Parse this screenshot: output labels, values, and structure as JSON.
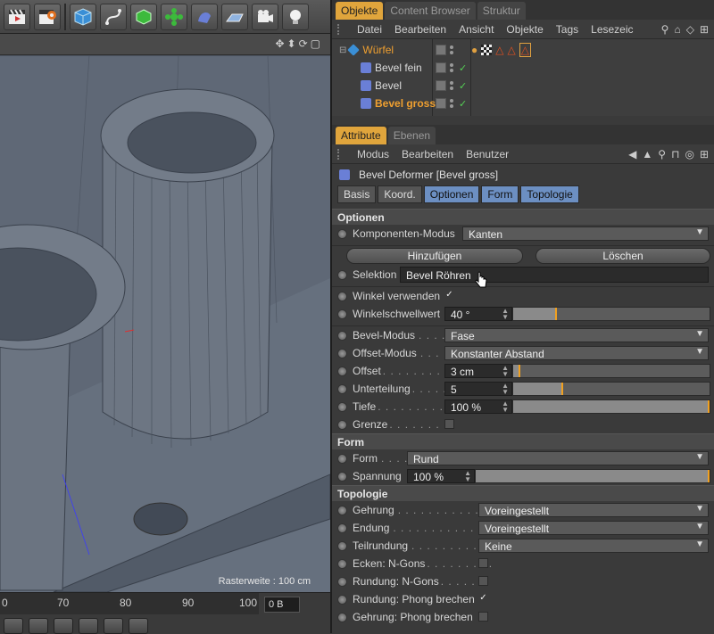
{
  "toolbar": {
    "icons": [
      "clapperboard-icon",
      "render-settings-icon",
      "cube-icon",
      "spline-icon",
      "generator-icon",
      "array-icon",
      "deformer-icon",
      "floor-icon",
      "camera-icon",
      "light-icon"
    ]
  },
  "viewport": {
    "raster_label": "Rasterweite : 100 cm"
  },
  "timeline": {
    "ticks": [
      "0",
      "70",
      "80",
      "90",
      "100"
    ],
    "frame_value": "0 B"
  },
  "object_manager": {
    "tabs": [
      "Objekte",
      "Content Browser",
      "Struktur"
    ],
    "menu": [
      "Datei",
      "Bearbeiten",
      "Ansicht",
      "Objekte",
      "Tags",
      "Lesezeic"
    ],
    "objects": [
      {
        "name": "Würfel",
        "level": 0,
        "selected": false
      },
      {
        "name": "Bevel fein",
        "level": 1,
        "selected": false
      },
      {
        "name": "Bevel",
        "level": 1,
        "selected": false
      },
      {
        "name": "Bevel gross",
        "level": 1,
        "selected": true
      }
    ]
  },
  "attribute_manager": {
    "tabs": [
      "Attribute",
      "Ebenen"
    ],
    "menu": [
      "Modus",
      "Bearbeiten",
      "Benutzer"
    ],
    "title": "Bevel Deformer [Bevel gross]",
    "subtabs": [
      "Basis",
      "Koord.",
      "Optionen",
      "Form",
      "Topologie"
    ],
    "optionen": {
      "header": "Optionen",
      "komponenten_label": "Komponenten-Modus",
      "komponenten_value": "Kanten",
      "add_button": "Hinzufügen",
      "delete_button": "Löschen",
      "selektion_label": "Selektion",
      "selektion_value": "Bevel Röhren",
      "winkel_verwenden_label": "Winkel verwenden",
      "winkel_verwenden_checked": "✓",
      "winkelschwellwert_label": "Winkelschwellwert",
      "winkelschwellwert_value": "40 °",
      "bevel_modus_label": "Bevel-Modus",
      "bevel_modus_value": "Fase",
      "offset_modus_label": "Offset-Modus",
      "offset_modus_value": "Konstanter Abstand",
      "offset_label": "Offset",
      "offset_value": "3 cm",
      "unterteilung_label": "Unterteilung",
      "unterteilung_value": "5",
      "tiefe_label": "Tiefe",
      "tiefe_value": "100 %",
      "grenze_label": "Grenze"
    },
    "form": {
      "header": "Form",
      "form_label": "Form",
      "form_value": "Rund",
      "spannung_label": "Spannung",
      "spannung_value": "100 %"
    },
    "topologie": {
      "header": "Topologie",
      "gehrung_label": "Gehrung",
      "gehrung_value": "Voreingestellt",
      "endung_label": "Endung",
      "endung_value": "Voreingestellt",
      "teilrundung_label": "Teilrundung",
      "teilrundung_value": "Keine",
      "ecken_label": "Ecken: N-Gons",
      "rundung_ngons_label": "Rundung: N-Gons",
      "rundung_phong_label": "Rundung: Phong brechen",
      "rundung_phong_checked": "✓",
      "gehrung_phong_label": "Gehrung: Phong brechen"
    }
  },
  "sliders": {
    "winkelschwellwert": 0.22,
    "offset": 0.03,
    "unterteilung": 0.25,
    "tiefe": 1.0,
    "spannung": 1.0
  }
}
